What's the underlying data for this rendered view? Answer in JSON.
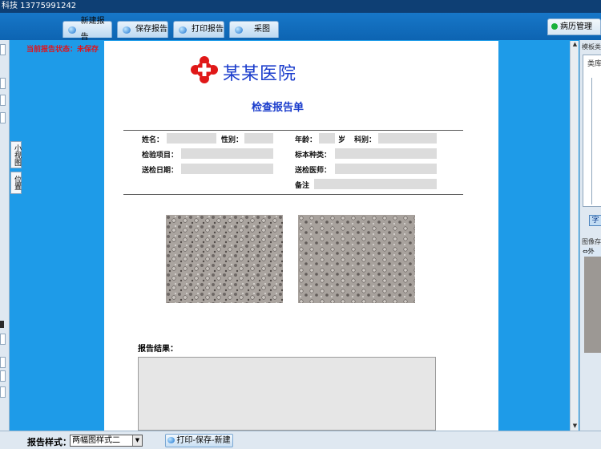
{
  "titlebar": {
    "text": "科技   13775991242"
  },
  "toolbar": {
    "buttons": [
      {
        "label": "新建报告"
      },
      {
        "label": "保存报告"
      },
      {
        "label": "打印报告"
      },
      {
        "label": "采图"
      }
    ],
    "emr_tab": "病历管理"
  },
  "left_panel": {
    "vtabs": [
      "小视图",
      "位置"
    ]
  },
  "status": {
    "text": "当前报告状态：未保存"
  },
  "report": {
    "hospital_name": "某某医院",
    "title": "检查报告单",
    "fields": {
      "name": "姓名：",
      "gender": "性别：",
      "age": "年龄：",
      "age_unit": "岁",
      "department": "科别：",
      "exam_item": "检验项目：",
      "specimen": "标本种类：",
      "send_date": "送检日期：",
      "doctor": "送检医师：",
      "remark": "备注"
    },
    "result_label": "报告结果："
  },
  "right_panel": {
    "section1": "模板类",
    "section1_tab": "类库",
    "button": "字",
    "section2": "图像存",
    "tree_item": "外"
  },
  "bottom": {
    "style_label": "报告样式：",
    "style_value": "两幅图样式二",
    "print_button": "打印-保存-新建"
  }
}
